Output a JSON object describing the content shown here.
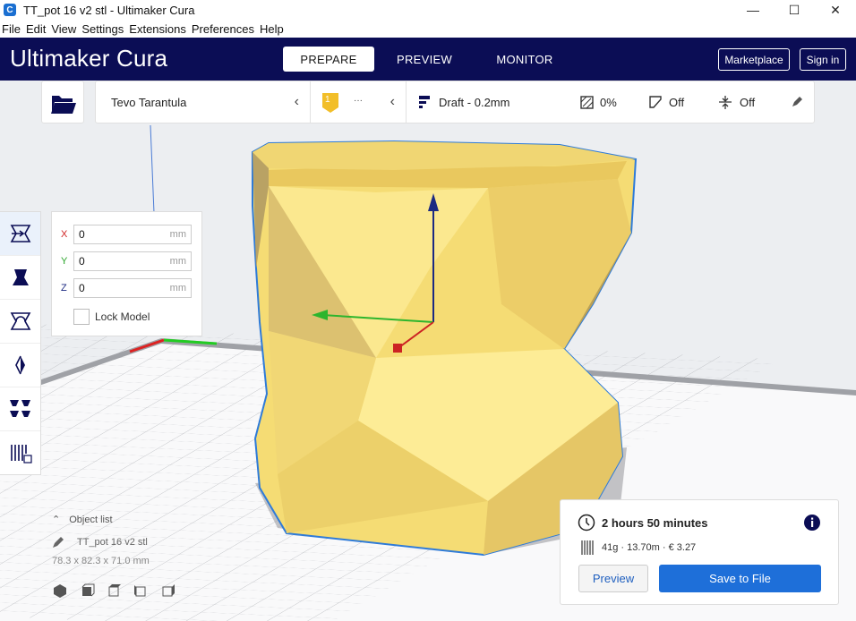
{
  "window": {
    "title": "TT_pot 16  v2 stl  - Ultimaker Cura",
    "minimize": "—",
    "maximize": "☐",
    "close": "✕"
  },
  "menu": [
    "File",
    "Edit",
    "View",
    "Settings",
    "Extensions",
    "Preferences",
    "Help"
  ],
  "header": {
    "logo_bold": "Ultimaker",
    "logo_light": " Cura",
    "tabs": [
      "PREPARE",
      "PREVIEW",
      "MONITOR"
    ],
    "active_tab": "PREPARE",
    "marketplace": "Marketplace",
    "signin": "Sign in"
  },
  "printer": {
    "name": "Tevo Tarantula",
    "extruder_number": "1",
    "extruder_more": "···",
    "profile": "Draft - 0.2mm",
    "infill": "0%",
    "support": "Off",
    "adhesion": "Off"
  },
  "move_panel": {
    "x_label": "X",
    "y_label": "Y",
    "z_label": "Z",
    "x_value": "0",
    "y_value": "0",
    "z_value": "0",
    "unit": "mm",
    "lock_label": "Lock Model",
    "lock_checked": false
  },
  "object_list": {
    "title": "Object list",
    "name": "TT_pot 16  v2 stl",
    "dimensions": "78.3 x 82.3 x 71.0 mm"
  },
  "result": {
    "time": "2 hours 50 minutes",
    "material": "41g · 13.70m · € 3.27",
    "preview_label": "Preview",
    "save_label": "Save to File"
  },
  "colors": {
    "header_bg": "#0b0d55",
    "accent": "#1e6fd9",
    "model": "#f5dc74",
    "model_outline": "#2f7bd8"
  }
}
